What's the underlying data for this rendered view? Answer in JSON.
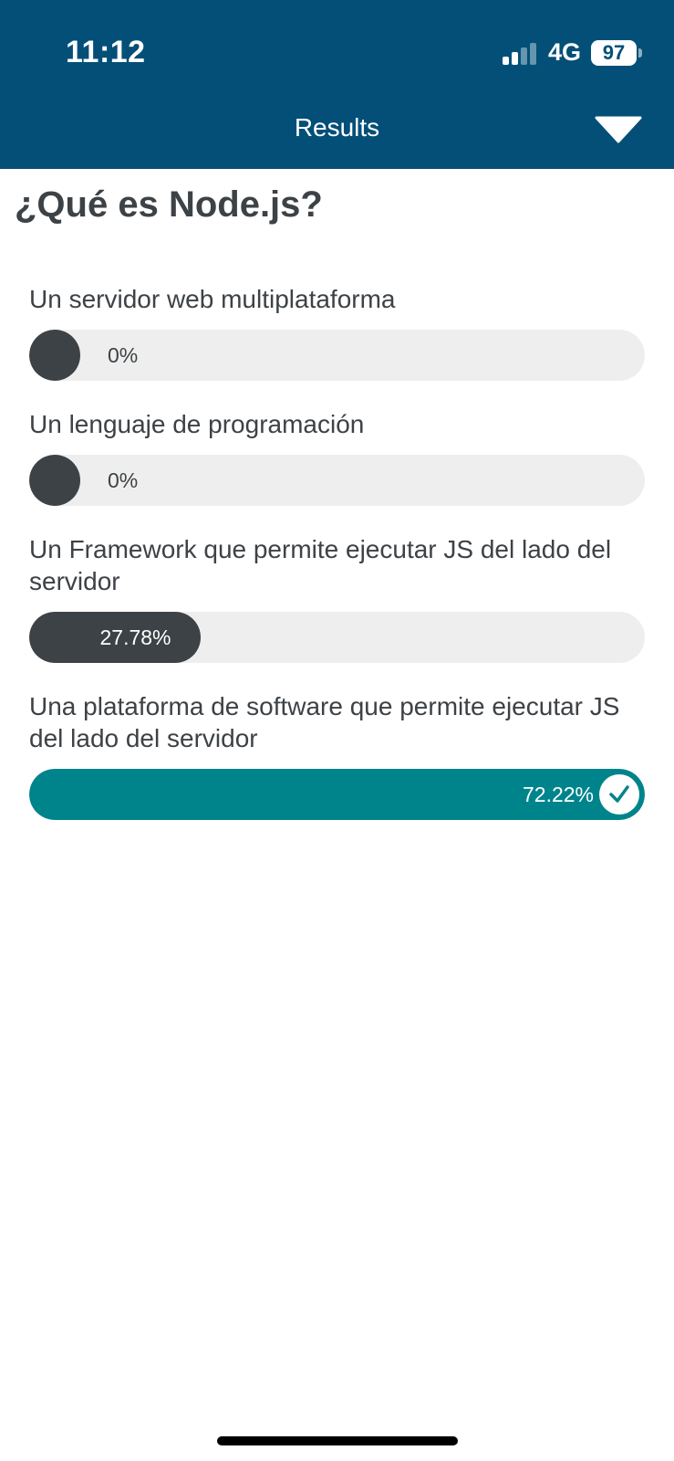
{
  "status_bar": {
    "time": "11:12",
    "network": "4G",
    "battery": "97",
    "signal_bars_active": 2,
    "signal_bars_total": 4
  },
  "header": {
    "title": "Results",
    "toggle_icon": "chevron-down-icon"
  },
  "question": "¿Qué es Node.js?",
  "options": [
    {
      "label": "Un servidor web multiplataforma",
      "percent_label": "0%",
      "percent": 0,
      "correct": false
    },
    {
      "label": "Un lenguaje de programación",
      "percent_label": "0%",
      "percent": 0,
      "correct": false
    },
    {
      "label": "Un Framework que permite ejecutar JS del lado del servidor",
      "percent_label": "27.78%",
      "percent": 27.78,
      "correct": false
    },
    {
      "label": "Una plataforma de software que permite ejecutar JS del lado del servidor",
      "percent_label": "72.22%",
      "percent": 72.22,
      "correct": true
    }
  ],
  "colors": {
    "header_bg": "#034f78",
    "bar_fill": "#3d4246",
    "bar_correct": "#00848c",
    "bar_track": "#eeeeee",
    "text": "#3d4246"
  },
  "icons": {
    "correct": "check-circle-icon"
  }
}
